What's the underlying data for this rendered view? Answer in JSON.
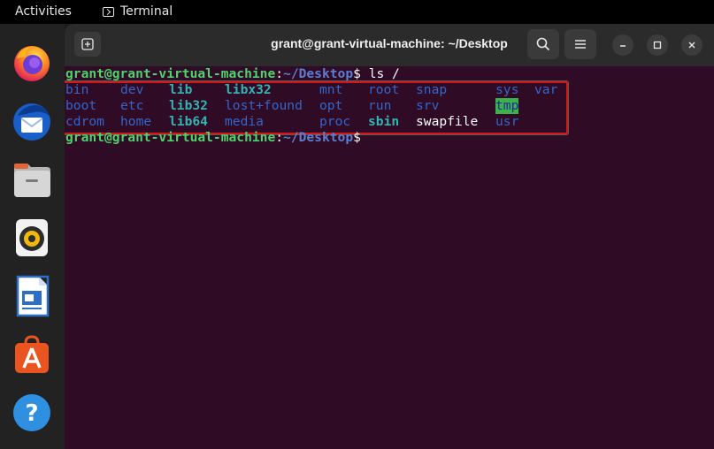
{
  "topbar": {
    "activities": "Activities",
    "app_name": "Terminal",
    "app_icon": "terminal-icon"
  },
  "dock": {
    "items": [
      {
        "name": "Firefox",
        "icon": "firefox-icon"
      },
      {
        "name": "Thunderbird",
        "icon": "thunderbird-icon"
      },
      {
        "name": "Files",
        "icon": "files-icon"
      },
      {
        "name": "Rhythmbox",
        "icon": "rhythmbox-icon"
      },
      {
        "name": "LibreOffice Writer",
        "icon": "writer-icon"
      },
      {
        "name": "Ubuntu Software",
        "icon": "software-icon"
      },
      {
        "name": "Help",
        "icon": "help-icon"
      }
    ]
  },
  "window": {
    "title": "grant@grant-virtual-machine: ~/Desktop",
    "icons": {
      "new_tab": "new-tab-icon",
      "search": "search-icon",
      "menu": "hamburger-menu-icon",
      "minimize": "minimize-icon",
      "maximize": "maximize-icon",
      "close": "close-icon"
    }
  },
  "terminal": {
    "prompt_user": "grant@grant-virtual-machine",
    "prompt_sep": ":",
    "prompt_path": "~/Desktop",
    "prompt_dollar": "$",
    "command": " ls /",
    "listing": {
      "row1": [
        "bin",
        "dev",
        "lib",
        "libx32",
        "mnt",
        "root",
        "snap",
        "sys",
        "var"
      ],
      "row2": [
        "boot",
        "etc",
        "lib32",
        "lost+found",
        "opt",
        "run",
        "srv",
        "tmp"
      ],
      "row3": [
        "cdrom",
        "home",
        "lib64",
        "media",
        "proc",
        "sbin",
        "swapfile",
        "usr"
      ]
    }
  },
  "colors": {
    "terminal_bg": "#2f0b25",
    "prompt_user": "#4ed36c",
    "prompt_path": "#5c7fd1",
    "directory": "#3465c8",
    "symlink": "#31b5b3",
    "sticky_dir_bg": "#3db24b",
    "highlight_box": "#d01818"
  }
}
